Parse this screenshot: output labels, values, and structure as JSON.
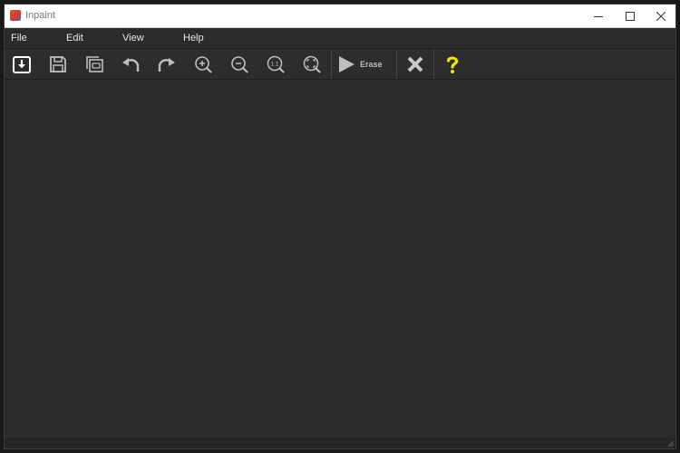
{
  "window": {
    "title": "Inpaint"
  },
  "menu": {
    "items": [
      "File",
      "Edit",
      "View",
      "Help"
    ]
  },
  "toolbar": {
    "buttons": [
      "open-icon",
      "save-icon",
      "save-copy-icon",
      "undo-icon",
      "redo-icon",
      "zoom-in-icon",
      "zoom-out-icon",
      "actual-size-icon",
      "fit-to-window-icon"
    ],
    "zoom_actual_label": "1:1",
    "erase_label": "Erase",
    "cancel": "close-x-icon",
    "help": "help-question-icon"
  },
  "colors": {
    "background": "#2b2b2b",
    "icon": "#bdbdbd",
    "help_accent": "#f0e600",
    "app_icon_red": "#d23b2f"
  }
}
